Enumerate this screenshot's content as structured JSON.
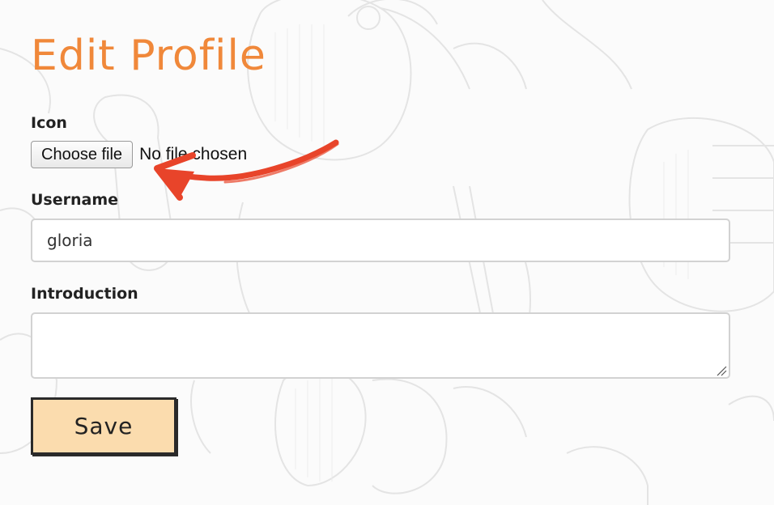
{
  "page": {
    "title": "Edit Profile",
    "accent_color": "#f0883a",
    "annotation_color": "#e8442a"
  },
  "form": {
    "icon": {
      "label": "Icon",
      "button_label": "Choose file",
      "status": "No file chosen"
    },
    "username": {
      "label": "Username",
      "value": "gloria"
    },
    "introduction": {
      "label": "Introduction",
      "value": ""
    },
    "save_label": "Save",
    "save_color": "#fbdcae"
  },
  "icons": {
    "annotation": "red-arrow-icon",
    "resize": "resize-grip-icon"
  }
}
